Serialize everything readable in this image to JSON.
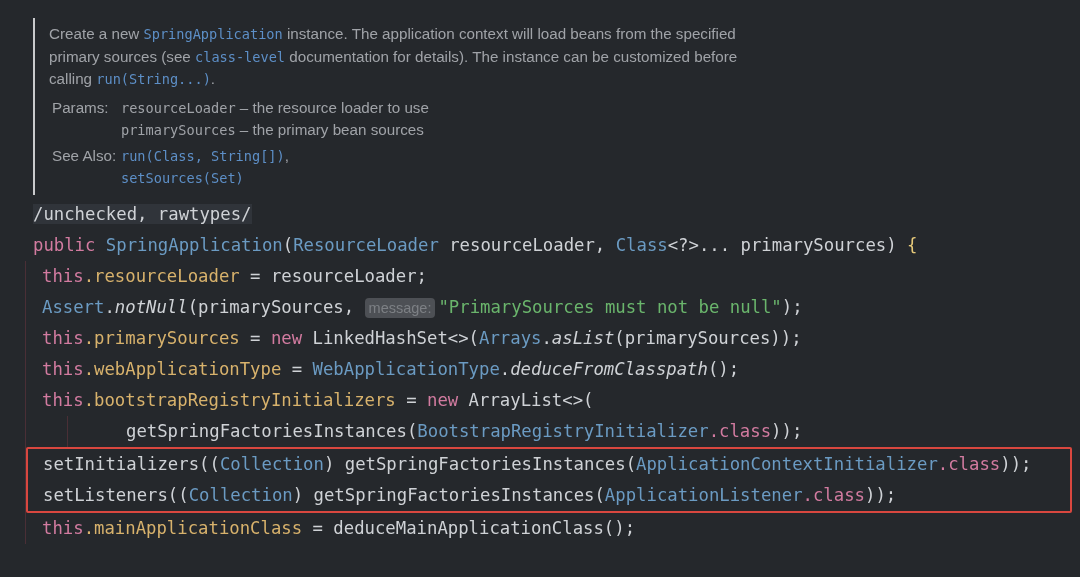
{
  "doc": {
    "description": [
      {
        "kind": "text",
        "text": "Create a new "
      },
      {
        "kind": "code",
        "text": "SpringApplication"
      },
      {
        "kind": "text",
        "text": " instance. The application context will load beans from the specified primary sources (see "
      },
      {
        "kind": "code",
        "text": "class-level"
      },
      {
        "kind": "text",
        "text": " documentation for details). The instance can be customized before calling "
      },
      {
        "kind": "code",
        "text": "run(String...)"
      },
      {
        "kind": "text",
        "text": "."
      }
    ],
    "sections": [
      {
        "label": "Params:",
        "entries": [
          [
            {
              "kind": "param",
              "text": "resourceLoader"
            },
            {
              "kind": "text",
              "text": " – the resource loader to use"
            }
          ],
          [
            {
              "kind": "param",
              "text": "primarySources"
            },
            {
              "kind": "text",
              "text": " – the primary bean sources"
            }
          ]
        ]
      },
      {
        "label": "See Also:",
        "entries": [
          [
            {
              "kind": "code",
              "text": "run(Class, String[])"
            },
            {
              "kind": "text",
              "text": ","
            }
          ],
          [
            {
              "kind": "code",
              "text": "setSources(Set)"
            }
          ]
        ]
      }
    ]
  },
  "code": [
    {
      "kind": "line",
      "tokens": [
        {
          "kind": "annotation",
          "text": "/unchecked, rawtypes/"
        }
      ]
    },
    {
      "kind": "line",
      "tokens": [
        {
          "kind": "keyword",
          "text": "public"
        },
        {
          "kind": "type",
          "text": " SpringApplication"
        },
        {
          "kind": "plain",
          "text": "("
        },
        {
          "kind": "type",
          "text": "ResourceLoader"
        },
        {
          "kind": "plain",
          "text": " resourceLoader, "
        },
        {
          "kind": "type",
          "text": "Class"
        },
        {
          "kind": "plain",
          "text": "<?>... primarySources) "
        },
        {
          "kind": "brace",
          "text": "{"
        }
      ],
      "children": [
        {
          "kind": "line",
          "tokens": [
            {
              "kind": "keyword",
              "text": "this"
            },
            {
              "kind": "field",
              "text": ".resourceLoader"
            },
            {
              "kind": "plain",
              "text": " = resourceLoader;"
            }
          ]
        },
        {
          "kind": "line",
          "tokens": [
            {
              "kind": "type",
              "text": "Assert"
            },
            {
              "kind": "plain",
              "text": "."
            },
            {
              "kind": "italic",
              "text": "notNull"
            },
            {
              "kind": "plain",
              "text": "(primarySources, "
            },
            {
              "kind": "hint",
              "text": "message:"
            },
            {
              "kind": "string",
              "text": "\"PrimarySources must not be null\""
            },
            {
              "kind": "plain",
              "text": ");"
            }
          ]
        },
        {
          "kind": "line",
          "tokens": [
            {
              "kind": "keyword",
              "text": "this"
            },
            {
              "kind": "field",
              "text": ".primarySources"
            },
            {
              "kind": "plain",
              "text": " = "
            },
            {
              "kind": "keyword",
              "text": "new"
            },
            {
              "kind": "plain",
              "text": " LinkedHashSet<>("
            },
            {
              "kind": "type",
              "text": "Arrays"
            },
            {
              "kind": "plain",
              "text": "."
            },
            {
              "kind": "italic",
              "text": "asList"
            },
            {
              "kind": "plain",
              "text": "(primarySources));"
            }
          ]
        },
        {
          "kind": "line",
          "tokens": [
            {
              "kind": "keyword",
              "text": "this"
            },
            {
              "kind": "field",
              "text": ".webApplicationType"
            },
            {
              "kind": "plain",
              "text": " = "
            },
            {
              "kind": "type",
              "text": "WebApplicationType"
            },
            {
              "kind": "plain",
              "text": "."
            },
            {
              "kind": "italic",
              "text": "deduceFromClasspath"
            },
            {
              "kind": "plain",
              "text": "();"
            }
          ]
        },
        {
          "kind": "line",
          "tokens": [
            {
              "kind": "keyword",
              "text": "this"
            },
            {
              "kind": "field",
              "text": ".bootstrapRegistryInitializers"
            },
            {
              "kind": "plain",
              "text": " = "
            },
            {
              "kind": "keyword",
              "text": "new"
            },
            {
              "kind": "plain",
              "text": " ArrayList<>("
            }
          ],
          "children": [
            {
              "kind": "continuation",
              "tokens": [
                {
                  "kind": "plain",
                  "text": "getSpringFactoriesInstances("
                },
                {
                  "kind": "type",
                  "text": "BootstrapRegistryInitializer"
                },
                {
                  "kind": "keyword",
                  "text": ".class"
                },
                {
                  "kind": "plain",
                  "text": "));"
                }
              ]
            }
          ]
        },
        {
          "kind": "highlight",
          "children": [
            {
              "kind": "line",
              "tokens": [
                {
                  "kind": "plain",
                  "text": "setInitializers(("
                },
                {
                  "kind": "type",
                  "text": "Collection"
                },
                {
                  "kind": "plain",
                  "text": ") getSpringFactoriesInstances("
                },
                {
                  "kind": "type",
                  "text": "ApplicationContextInitializer"
                },
                {
                  "kind": "keyword",
                  "text": ".class"
                },
                {
                  "kind": "plain",
                  "text": "));"
                }
              ]
            },
            {
              "kind": "line",
              "tokens": [
                {
                  "kind": "plain",
                  "text": "setListeners(("
                },
                {
                  "kind": "type",
                  "text": "Collection"
                },
                {
                  "kind": "plain",
                  "text": ") getSpringFactoriesInstances("
                },
                {
                  "kind": "type",
                  "text": "ApplicationListener"
                },
                {
                  "kind": "keyword",
                  "text": ".class"
                },
                {
                  "kind": "plain",
                  "text": "));"
                }
              ]
            }
          ]
        },
        {
          "kind": "line",
          "tokens": [
            {
              "kind": "keyword",
              "text": "this"
            },
            {
              "kind": "field",
              "text": ".mainApplicationClass"
            },
            {
              "kind": "plain",
              "text": " = deduceMainApplicationClass();"
            }
          ]
        }
      ]
    }
  ]
}
